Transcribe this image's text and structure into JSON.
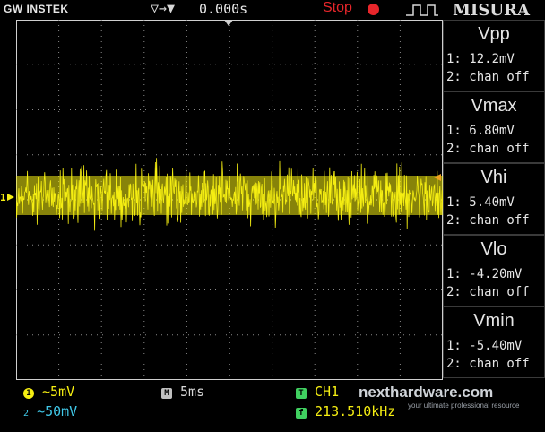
{
  "header": {
    "brand": "GW INSTEK",
    "trigger_symbol": "▽→▼",
    "time_offset": "0.000s",
    "run_state": "Stop",
    "tab_label": "MISURA"
  },
  "measurements": [
    {
      "title": "Vpp",
      "line1": "1: 12.2mV",
      "line2": "2: chan off"
    },
    {
      "title": "Vmax",
      "line1": "1: 6.80mV",
      "line2": "2: chan off"
    },
    {
      "title": "Vhi",
      "line1": "1: 5.40mV",
      "line2": "2: chan off"
    },
    {
      "title": "Vlo",
      "line1": "1: -4.20mV",
      "line2": "2: chan off"
    },
    {
      "title": "Vmin",
      "line1": "1: -5.40mV",
      "line2": "2: chan off"
    }
  ],
  "footer": {
    "ch1_badge": "1",
    "ch1_scale": "~5mV",
    "ch2_badge": "2",
    "ch2_scale": "~50mV",
    "timebase_badge": "M",
    "timebase": "5ms",
    "trigger_badge": "T",
    "trigger_source": "CH1",
    "freq_badge": "f",
    "frequency": "213.510kHz"
  },
  "ch1_marker": "1",
  "watermark": {
    "main": "nexthardware.com",
    "sub": "your ultimate professional resource"
  },
  "colors": {
    "ch1": "#f5ee12",
    "ch2": "#40c8e8",
    "stop": "#e8262b",
    "grid": "#8a8a8a",
    "trigger_badge": "#40d060"
  }
}
